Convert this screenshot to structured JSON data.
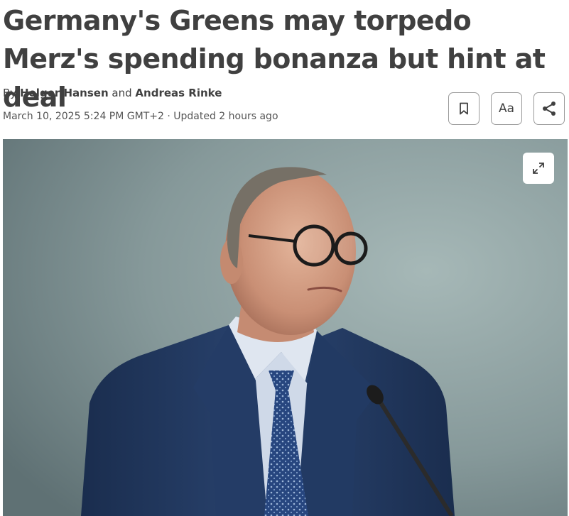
{
  "article": {
    "headline": "Germany's Greens may torpedo Merz's spending bonanza but hint at deal",
    "byline": {
      "prefix": "By",
      "author_1": "Holger Hansen",
      "connector": "and",
      "author_2": "Andreas Rinke"
    },
    "dateline": {
      "published": "March 10, 2025 5:24 PM GMT+2",
      "separator": "·",
      "updated": "Updated 2 hours ago"
    }
  },
  "actions": {
    "bookmark_icon": "bookmark-icon",
    "text_size_label": "Aa",
    "share_icon": "share-icon"
  },
  "image": {
    "expand_icon": "expand-icon"
  },
  "colors": {
    "text": "#404040",
    "border": "#9a9a9a",
    "photo_background": "#7f9494",
    "suit": "#1f3558"
  }
}
